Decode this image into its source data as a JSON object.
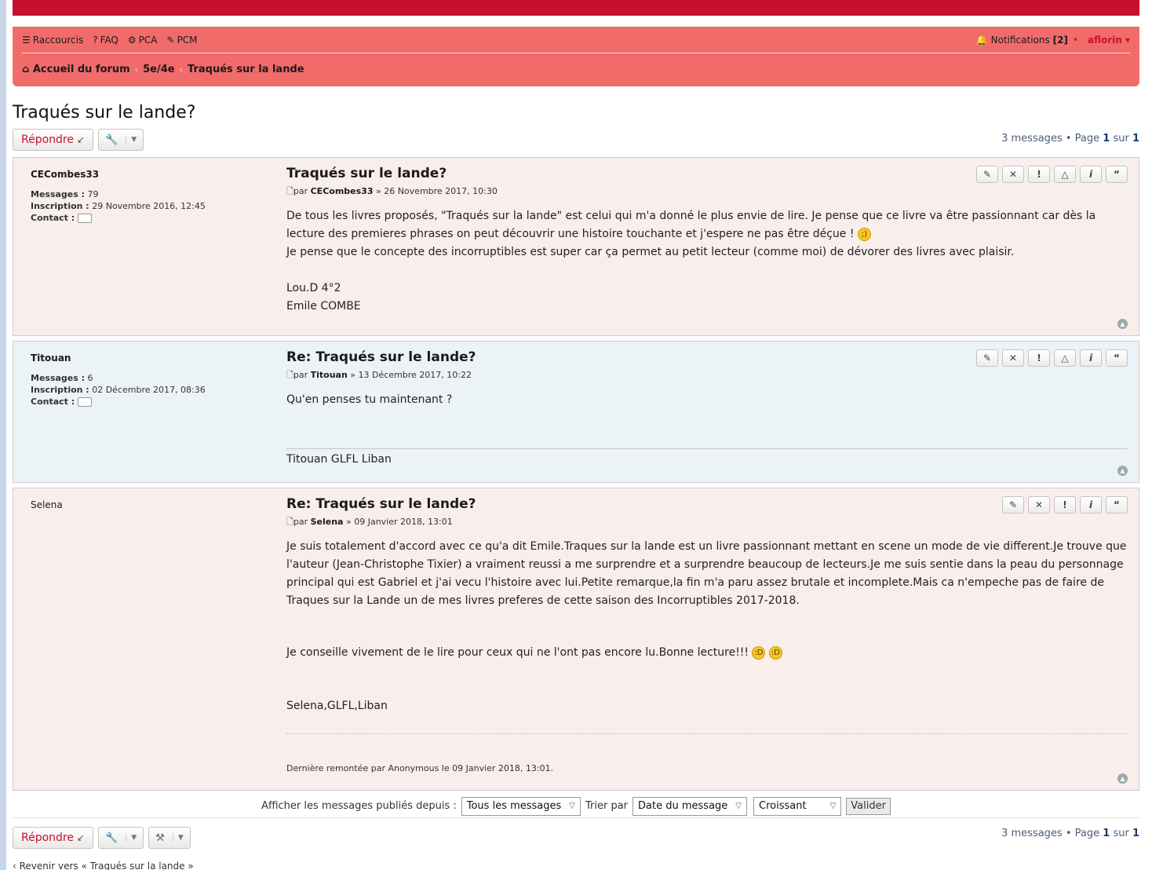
{
  "nav": {
    "quicklinks": "Raccourcis",
    "faq": "FAQ",
    "pca": "PCA",
    "pcm": "PCM",
    "notifications_label": "Notifications",
    "notifications_count": "[2]",
    "username": "aflorin"
  },
  "breadcrumb": {
    "home": "Accueil du forum",
    "level1": "5e/4e",
    "level2": "Traqués sur la lande"
  },
  "topic": {
    "title": "Traqués sur le lande?",
    "reply_label": "Répondre",
    "pagination_text": "3 messages • Page",
    "page_current": "1",
    "page_sep": "sur",
    "page_total": "1"
  },
  "posts": [
    {
      "user": "CECombes33",
      "messages_label": "Messages :",
      "messages": "79",
      "joined_label": "Inscription :",
      "joined": "29 Novembre 2016, 12:45",
      "contact_label": "Contact :",
      "title": "Traqués sur le lande?",
      "by": "par",
      "date": "» 26 Novembre 2017, 10:30",
      "body1": "De tous les livres proposés, \"Traqués sur la lande\" est celui qui m'a donné le plus envie de lire. Je pense que ce livre va être passionnant car dès la lecture des premieres phrases on peut découvrir une histoire touchante et j'espere ne pas être déçue !",
      "body2": "Je pense que le concepte des incorruptibles est super car ça permet au petit lecteur (comme moi) de dévorer des livres avec plaisir.",
      "body3": "Lou.D 4°2",
      "body4": "Emile COMBE"
    },
    {
      "user": "Titouan",
      "messages_label": "Messages :",
      "messages": "6",
      "joined_label": "Inscription :",
      "joined": "02 Décembre 2017, 08:36",
      "contact_label": "Contact :",
      "title": "Re: Traqués sur le lande?",
      "by": "par",
      "date": "» 13 Décembre 2017, 10:22",
      "body1": "Qu'en penses tu maintenant ?",
      "signature": "Titouan GLFL Liban"
    },
    {
      "user": "Selena",
      "title": "Re: Traqués sur le lande?",
      "by": "par",
      "date": "» 09 Janvier 2018, 13:01",
      "body1": "Je suis totalement d'accord avec ce qu'a dit Emile.Traques sur la lande est un livre passionnant mettant en scene un mode de vie different.Je trouve que l'auteur (Jean-Christophe Tixier) a vraiment reussi a me surprendre et a surprendre beaucoup de lecteurs.Je me suis sentie dans la peau du personnage principal qui est Gabriel et j'ai vecu l'histoire avec lui.Petite remarque,la fin m'a paru assez brutale et incomplete.Mais ca n'empeche pas de faire de Traques sur la Lande un de mes livres preferes de cette saison des Incorruptibles 2017-2018.",
      "body2": "Je conseille vivement de le lire pour ceux qui ne l'ont pas encore lu.Bonne lecture!!!",
      "body3": "Selena,GLFL,Liban",
      "edit_note": "Dernière remontée par Anonymous le 09 Janvier 2018, 13:01."
    }
  ],
  "sort": {
    "show_label": "Afficher les messages publiés depuis :",
    "show_value": "Tous les messages",
    "sort_label": "Trier par",
    "sort_value": "Date du message",
    "order_value": "Croissant",
    "submit": "Valider"
  },
  "footer": {
    "back_link": "‹ Revenir vers « Traqués sur la lande »"
  }
}
